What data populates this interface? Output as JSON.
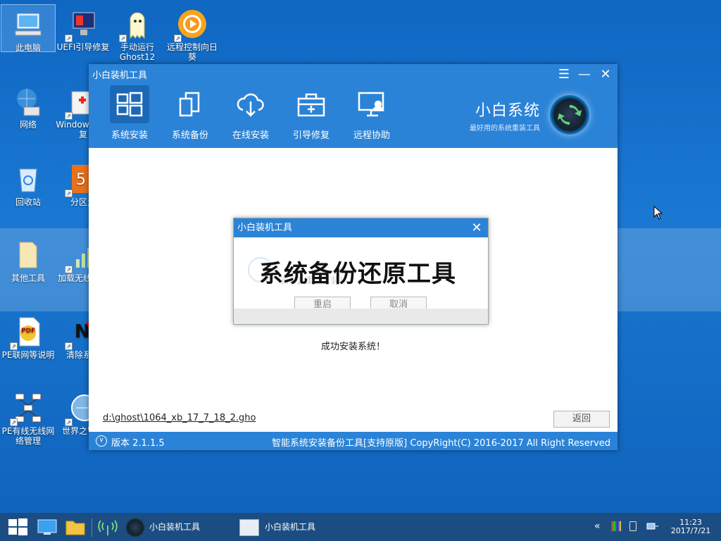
{
  "desktop": {
    "icons": [
      {
        "label": "此电脑"
      },
      {
        "label": "UEFI引导修复"
      },
      {
        "label": "手动运行Ghost12"
      },
      {
        "label": "远程控制向日葵"
      },
      {
        "label": "网络"
      },
      {
        "label": "Windows导修复"
      },
      {
        "label": "回收站"
      },
      {
        "label": "分区大"
      },
      {
        "label": "其他工具"
      },
      {
        "label": "加载无线驱动"
      },
      {
        "label": "PE联网等说明"
      },
      {
        "label": "清除系统"
      },
      {
        "label": "PE有线无线网络管理"
      },
      {
        "label": "世界之窗器"
      }
    ]
  },
  "window": {
    "title": "小白装机工具",
    "controls": {
      "menu": "☰",
      "minimize": "—",
      "close": "✕"
    },
    "toolbar": [
      {
        "label": "系统安装",
        "icon": "windows-grid-icon"
      },
      {
        "label": "系统备份",
        "icon": "copy-icon"
      },
      {
        "label": "在线安装",
        "icon": "cloud-download-icon"
      },
      {
        "label": "引导修复",
        "icon": "toolbox-icon"
      },
      {
        "label": "远程协助",
        "icon": "monitor-person-icon"
      }
    ],
    "brand": {
      "name": "小白系统",
      "tagline": "最好用的系统重装工具"
    },
    "status_message": "成功安装系统！",
    "ghost_path": "d:\\ghost\\1064_xb_17_7_18_2.gho",
    "back_button": "返回",
    "footer": {
      "version": "版本 2.1.1.5",
      "copyright": "智能系统安装备份工具[支持原版]  CopyRight(C) 2016-2017 All Right Reserved"
    }
  },
  "dialog": {
    "title": "小白装机工具",
    "overlay_title": "系统备份还原工具",
    "faded_text": "安装】重新安装!)",
    "buttons": {
      "restart": "重启",
      "cancel": "取消"
    }
  },
  "taskbar": {
    "tasks": [
      {
        "label": "小白装机工具"
      },
      {
        "label": "小白装机工具"
      }
    ],
    "clock": {
      "time": "11:23",
      "date": "2017/7/21"
    }
  },
  "colors": {
    "accent": "#2b83d7",
    "desktop": "#1a78d2",
    "taskbar": "#1c4d82"
  }
}
